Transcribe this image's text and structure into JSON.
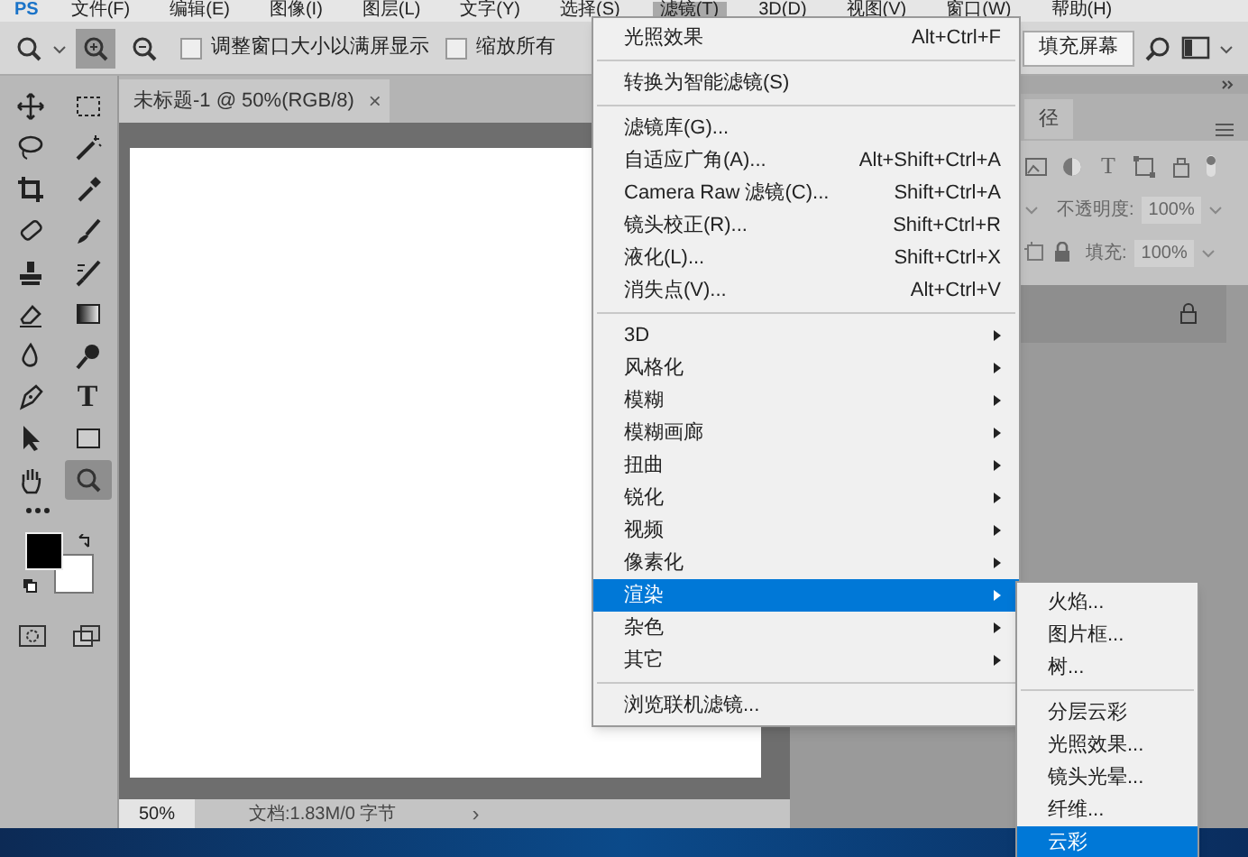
{
  "menubar": {
    "logo": "PS",
    "items": [
      {
        "label": "文件(F)",
        "selected": false
      },
      {
        "label": "编辑(E)",
        "selected": false
      },
      {
        "label": "图像(I)",
        "selected": false
      },
      {
        "label": "图层(L)",
        "selected": false
      },
      {
        "label": "文字(Y)",
        "selected": false
      },
      {
        "label": "选择(S)",
        "selected": false
      },
      {
        "label": "滤镜(T)",
        "selected": true
      },
      {
        "label": "3D(D)",
        "selected": false
      },
      {
        "label": "视图(V)",
        "selected": false
      },
      {
        "label": "窗口(W)",
        "selected": false
      },
      {
        "label": "帮助(H)",
        "selected": false
      }
    ]
  },
  "options_bar": {
    "zoom_buttons": [
      {
        "selected": true
      },
      {
        "selected": false
      }
    ],
    "checkboxes": [
      {
        "label": "调整窗口大小以满屏显示",
        "checked": false
      },
      {
        "label": "缩放所有",
        "checked": false
      }
    ],
    "fill_screen_button": "填充屏幕"
  },
  "tools": [
    {
      "selected": false
    },
    {
      "selected": false
    },
    {
      "selected": false
    },
    {
      "selected": false
    },
    {
      "selected": false
    },
    {
      "selected": false
    },
    {
      "selected": false
    },
    {
      "selected": false
    },
    {
      "selected": false
    },
    {
      "selected": false
    },
    {
      "selected": false
    },
    {
      "selected": false
    },
    {
      "selected": false
    },
    {
      "selected": false
    },
    {
      "selected": false
    },
    {
      "selected": false,
      "glyph": "T"
    },
    {
      "selected": false
    },
    {
      "selected": false
    },
    {
      "selected": false
    },
    {
      "selected": true
    }
  ],
  "document": {
    "tab_title": "未标题-1 @ 50%(RGB/8)",
    "close": "×",
    "zoom": "50%",
    "info": "文档:1.83M/0 字节",
    "nav": "›"
  },
  "layers_panel": {
    "tab": "径",
    "filter_glyph": "T",
    "opacity_label": "不透明度:",
    "opacity": "100%",
    "fill_label": "填充:",
    "fill": "100%"
  },
  "filter_menu": [
    {
      "kind": "item",
      "label": "光照效果",
      "shortcut": "Alt+Ctrl+F",
      "selected": false
    },
    {
      "kind": "separator"
    },
    {
      "kind": "item",
      "label": "转换为智能滤镜(S)",
      "selected": false
    },
    {
      "kind": "separator"
    },
    {
      "kind": "item",
      "label": "滤镜库(G)...",
      "selected": false
    },
    {
      "kind": "item",
      "label": "自适应广角(A)...",
      "shortcut": "Alt+Shift+Ctrl+A",
      "selected": false
    },
    {
      "kind": "item",
      "label": "Camera Raw 滤镜(C)...",
      "shortcut": "Shift+Ctrl+A",
      "selected": false
    },
    {
      "kind": "item",
      "label": "镜头校正(R)...",
      "shortcut": "Shift+Ctrl+R",
      "selected": false
    },
    {
      "kind": "item",
      "label": "液化(L)...",
      "shortcut": "Shift+Ctrl+X",
      "selected": false
    },
    {
      "kind": "item",
      "label": "消失点(V)...",
      "shortcut": "Alt+Ctrl+V",
      "selected": false
    },
    {
      "kind": "separator"
    },
    {
      "kind": "submenu",
      "label": "3D",
      "selected": false
    },
    {
      "kind": "submenu",
      "label": "风格化",
      "selected": false
    },
    {
      "kind": "submenu",
      "label": "模糊",
      "selected": false
    },
    {
      "kind": "submenu",
      "label": "模糊画廊",
      "selected": false
    },
    {
      "kind": "submenu",
      "label": "扭曲",
      "selected": false
    },
    {
      "kind": "submenu",
      "label": "锐化",
      "selected": false
    },
    {
      "kind": "submenu",
      "label": "视频",
      "selected": false
    },
    {
      "kind": "submenu",
      "label": "像素化",
      "selected": false
    },
    {
      "kind": "submenu",
      "label": "渲染",
      "selected": true
    },
    {
      "kind": "submenu",
      "label": "杂色",
      "selected": false
    },
    {
      "kind": "submenu",
      "label": "其它",
      "selected": false
    },
    {
      "kind": "separator"
    },
    {
      "kind": "item",
      "label": "浏览联机滤镜...",
      "selected": false
    }
  ],
  "render_submenu": [
    {
      "kind": "item",
      "label": "火焰...",
      "selected": false
    },
    {
      "kind": "item",
      "label": "图片框...",
      "selected": false
    },
    {
      "kind": "item",
      "label": "树...",
      "selected": false
    },
    {
      "kind": "separator"
    },
    {
      "kind": "item",
      "label": "分层云彩",
      "selected": false
    },
    {
      "kind": "item",
      "label": "光照效果...",
      "selected": false
    },
    {
      "kind": "item",
      "label": "镜头光晕...",
      "selected": false
    },
    {
      "kind": "item",
      "label": "纤维...",
      "selected": false
    },
    {
      "kind": "item",
      "label": "云彩",
      "selected": true
    }
  ]
}
